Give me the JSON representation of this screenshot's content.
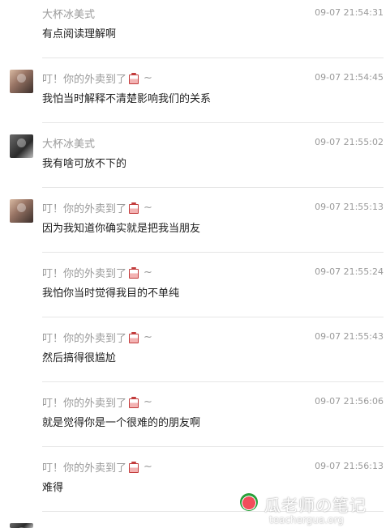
{
  "messages": [
    {
      "sender": "大杯冰美式",
      "cup_icon": false,
      "time": "09-07 21:54:31",
      "text": "有点阅读理解啊",
      "avatar": "none"
    },
    {
      "sender": "叮！你的外卖到了",
      "cup_icon": true,
      "tilde": "~",
      "time": "09-07 21:54:45",
      "text": "我怕当时解释不清楚影响我们的关系",
      "avatar": "type-b"
    },
    {
      "sender": "大杯冰美式",
      "cup_icon": false,
      "time": "09-07 21:55:02",
      "text": "我有啥可放不下的",
      "avatar": "type-a"
    },
    {
      "sender": "叮！你的外卖到了",
      "cup_icon": true,
      "tilde": "~",
      "time": "09-07 21:55:13",
      "text": "因为我知道你确实就是把我当朋友",
      "avatar": "type-b"
    },
    {
      "sender": "叮！你的外卖到了",
      "cup_icon": true,
      "tilde": "~",
      "time": "09-07 21:55:24",
      "text": "我怕你当时觉得我目的不单纯",
      "avatar": "none"
    },
    {
      "sender": "叮！你的外卖到了",
      "cup_icon": true,
      "tilde": "~",
      "time": "09-07 21:55:43",
      "text": "然后搞得很尴尬",
      "avatar": "none"
    },
    {
      "sender": "叮！你的外卖到了",
      "cup_icon": true,
      "tilde": "~",
      "time": "09-07 21:56:06",
      "text": "就是觉得你是一个很难的的朋友啊",
      "avatar": "none"
    },
    {
      "sender": "叮！你的外卖到了",
      "cup_icon": true,
      "tilde": "~",
      "time": "09-07 21:56:13",
      "text": "难得",
      "avatar": "none"
    }
  ],
  "watermark": {
    "title": "瓜老师の笔记",
    "url": "teachergua.org"
  },
  "icons": {
    "cup": "bubble-tea-cup-icon",
    "melon": "watermelon-logo-icon"
  },
  "colors": {
    "name_gray": "#9a9a9a",
    "text_dark": "#1f1f1f",
    "divider": "#e6e6e6",
    "cup_red": "#c23b3b"
  }
}
